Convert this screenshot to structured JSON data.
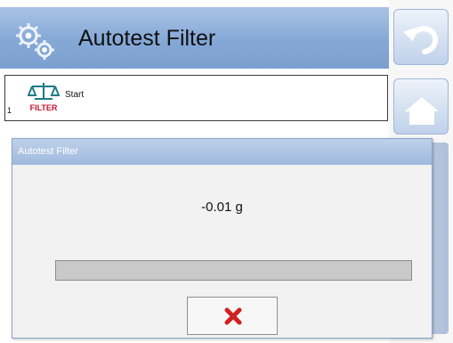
{
  "header": {
    "title": "Autotest Filter",
    "icon": "gears-icon"
  },
  "sidebar": {
    "buttons": [
      "back-arrow-icon",
      "home-icon"
    ]
  },
  "row": {
    "index": "1",
    "icon": "filter-icon",
    "icon_text": "FILTER",
    "label": "Start"
  },
  "dialog": {
    "title": "Autotest Filter",
    "value": "-0.01 g",
    "progress_percent": 0,
    "cancel_icon": "close-icon",
    "cancel_color": "#d02020"
  }
}
